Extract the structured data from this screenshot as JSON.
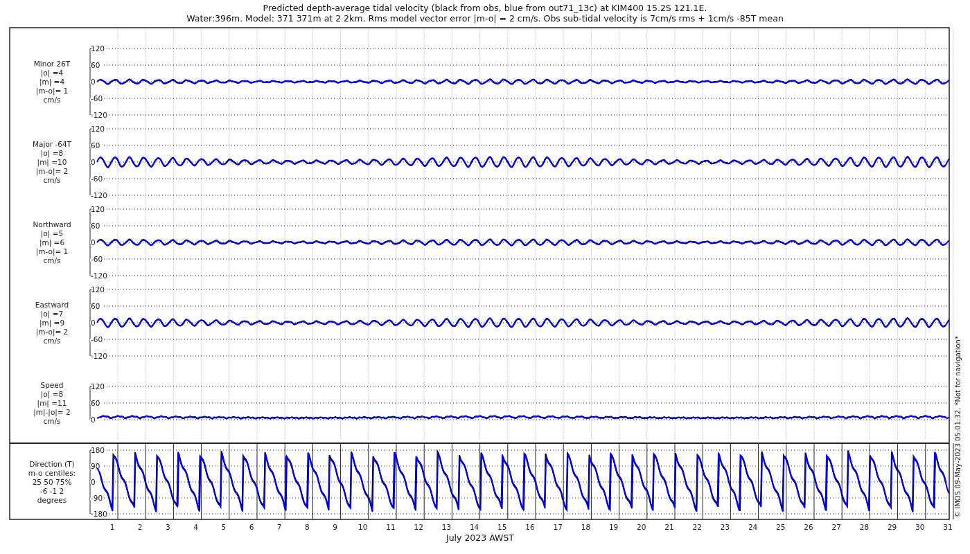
{
  "title_lines": [
    "Predicted depth-average tidal velocity (black from obs, blue from out71_13c) at KIM400 15.2S 121.1E.",
    "Water:396m. Model: 371 371m at 2 2km. Rms model vector error |m-o| = 2 cm/s. Obs sub-tidal velocity is 7cm/s rms + 1cm/s -85T mean"
  ],
  "panels": [
    {
      "kind": "signed",
      "label_lines": [
        "Minor 26T",
        "|o| =4",
        "|m| =4",
        "|m-o|= 1",
        "cm/s"
      ],
      "yticks": [
        "120",
        "60",
        "0",
        "-60",
        "-120"
      ]
    },
    {
      "kind": "signed",
      "label_lines": [
        "Major -64T",
        "|o| =8",
        "|m| =10",
        "|m-o|= 2",
        "cm/s"
      ],
      "yticks": [
        "120",
        "60",
        "0",
        "-60",
        "-120"
      ]
    },
    {
      "kind": "signed",
      "label_lines": [
        "Northward",
        "|o| =5",
        "|m| =6",
        "|m-o|= 1",
        "cm/s"
      ],
      "yticks": [
        "120",
        "60",
        "0",
        "-60",
        "-120"
      ]
    },
    {
      "kind": "signed",
      "label_lines": [
        "Eastward",
        "|o| =7",
        "|m| =9",
        "|m-o|= 2",
        "cm/s"
      ],
      "yticks": [
        "120",
        "60",
        "0",
        "-60",
        "-120"
      ]
    },
    {
      "kind": "speed",
      "label_lines": [
        "Speed",
        "|o| =8",
        "|m| =11",
        "|m|-|o|= 2",
        "cm/s"
      ],
      "yticks": [
        "120",
        "60",
        "0"
      ]
    },
    {
      "kind": "direction",
      "label_lines": [
        "Direction (T)",
        "m-o centiles:",
        "25  50  75%",
        "-6 -1  2",
        "degrees"
      ],
      "yticks": [
        "180",
        "90",
        "0",
        "-90",
        "-180"
      ]
    }
  ],
  "day_labels": [
    "1",
    "2",
    "3",
    "4",
    "5",
    "6",
    "7",
    "8",
    "9",
    "10",
    "11",
    "12",
    "13",
    "14",
    "15",
    "16",
    "17",
    "18",
    "19",
    "20",
    "21",
    "22",
    "23",
    "24",
    "25",
    "26",
    "27",
    "28",
    "29",
    "30",
    "31"
  ],
  "xlabel": "July 2023 AWST",
  "credit": "© IMOS 09-May-2023 05:01:32. *Not for navigation*"
}
